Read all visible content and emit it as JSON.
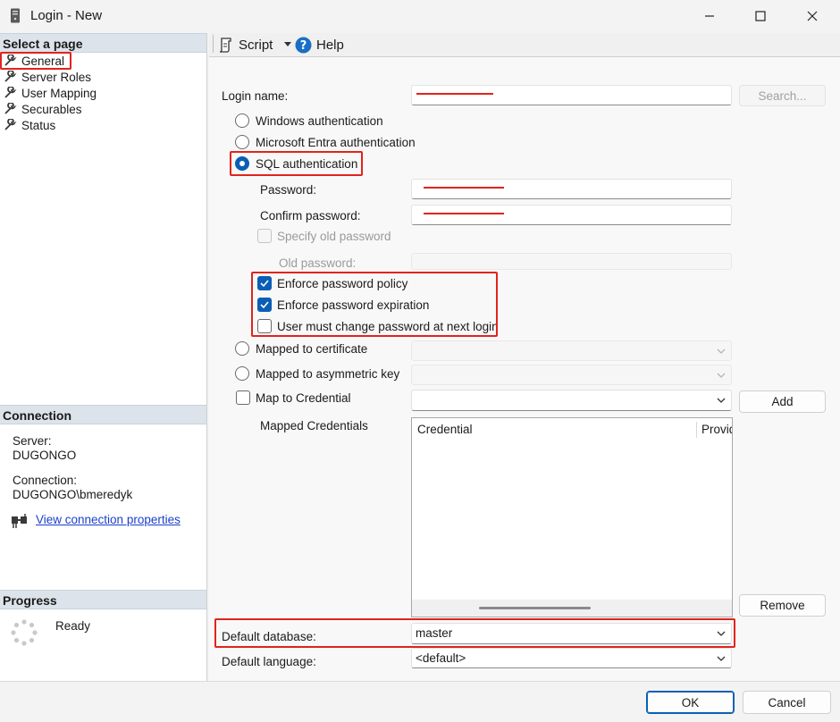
{
  "window": {
    "title": "Login - New"
  },
  "left": {
    "select_page": "Select a page",
    "nav": [
      "General",
      "Server Roles",
      "User Mapping",
      "Securables",
      "Status"
    ],
    "connection_head": "Connection",
    "server_label": "Server:",
    "server_value": "DUGONGO",
    "connection_label": "Connection:",
    "connection_value": "DUGONGO\\bmeredyk",
    "view_props": "View connection properties",
    "progress_head": "Progress",
    "progress_status": "Ready"
  },
  "toolbar": {
    "script": "Script",
    "help": "Help"
  },
  "form": {
    "login_name_label": "Login name:",
    "search_button": "Search...",
    "auth_windows": "Windows authentication",
    "auth_entra": "Microsoft Entra authentication",
    "auth_sql": "SQL authentication",
    "password_label": "Password:",
    "confirm_password_label": "Confirm password:",
    "specify_old_password": "Specify old password",
    "old_password_label": "Old password:",
    "enforce_policy": "Enforce password policy",
    "enforce_expiration": "Enforce password expiration",
    "must_change": "User must change password at next login",
    "mapped_cert": "Mapped to certificate",
    "mapped_asym": "Mapped to asymmetric key",
    "map_credential": "Map to Credential",
    "add_button": "Add",
    "mapped_credentials_label": "Mapped Credentials",
    "cred_columns": [
      "Credential",
      "Provider"
    ],
    "remove_button": "Remove",
    "default_db_label": "Default database:",
    "default_db_value": "master",
    "default_lang_label": "Default language:",
    "default_lang_value": "<default>"
  },
  "footer": {
    "ok": "OK",
    "cancel": "Cancel"
  },
  "colors": {
    "accent": "#0a5fb4",
    "highlight": "#e0241c",
    "link": "#1a3fcc"
  }
}
